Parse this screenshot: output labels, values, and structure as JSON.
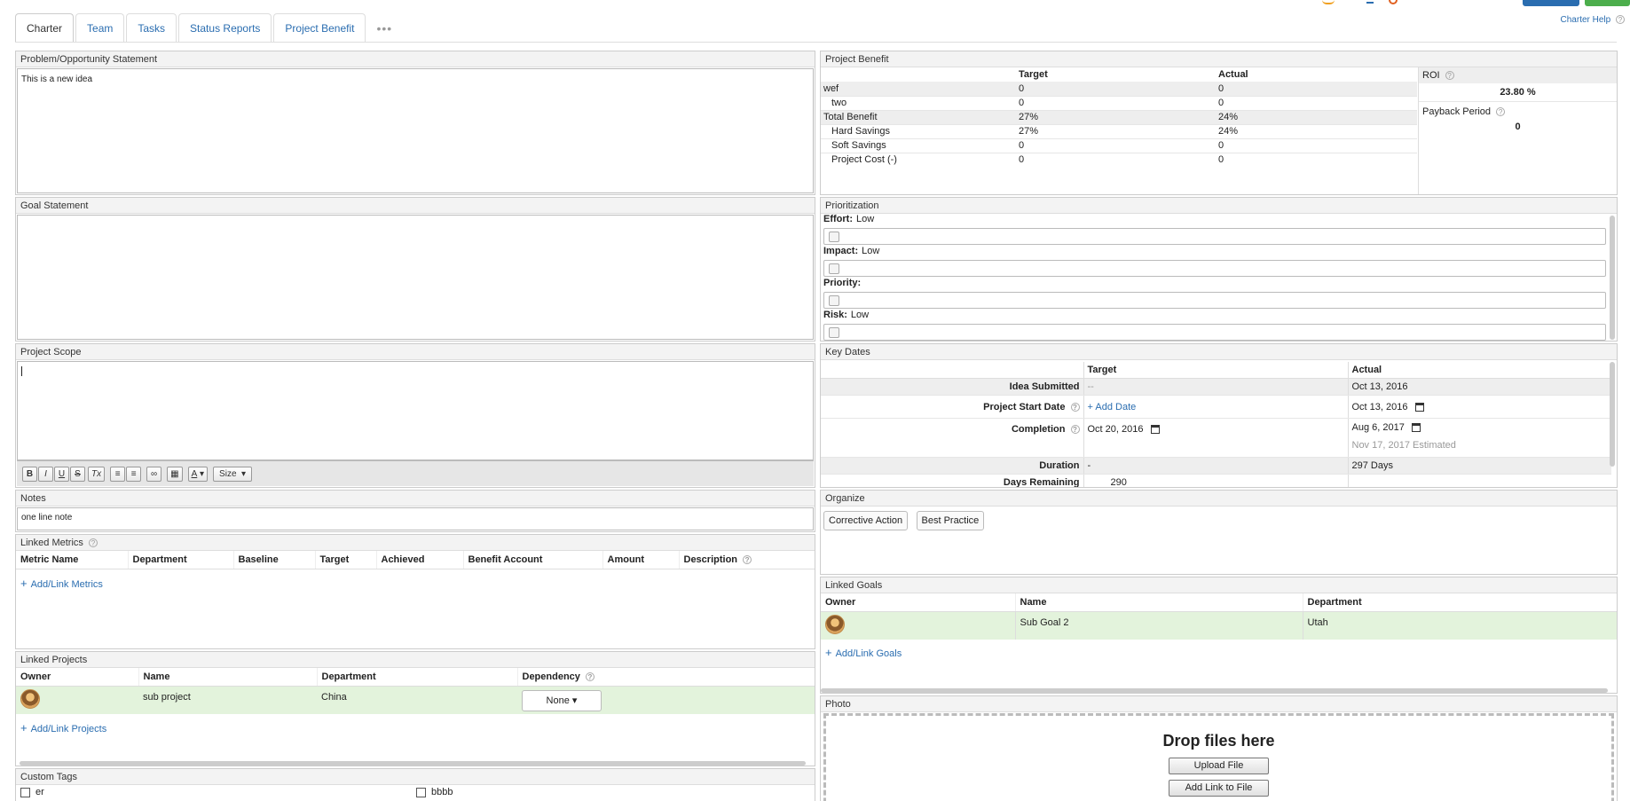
{
  "tabs": [
    "Charter",
    "Team",
    "Tasks",
    "Status Reports",
    "Project Benefit"
  ],
  "tab_more": "•••",
  "help_link": "Charter Help",
  "problem": {
    "title": "Problem/Opportunity Statement",
    "text": "This is a new idea"
  },
  "goal": {
    "title": "Goal Statement",
    "text": ""
  },
  "scope": {
    "title": "Project Scope",
    "toolbar": {
      "bold": "B",
      "italic": "I",
      "underline": "U",
      "strike": "S",
      "clear": "Tx",
      "font_color": "A",
      "size": "Size"
    }
  },
  "notes": {
    "title": "Notes",
    "text": "one line note"
  },
  "linked_metrics": {
    "title": "Linked Metrics",
    "columns": [
      "Metric Name",
      "Department",
      "Baseline",
      "Target",
      "Achieved",
      "Benefit Account",
      "Amount",
      "Description"
    ],
    "add_link": "Add/Link Metrics"
  },
  "linked_projects": {
    "title": "Linked Projects",
    "columns": [
      "Owner",
      "Name",
      "Department",
      "Dependency"
    ],
    "rows": [
      {
        "name": "sub project",
        "department": "China",
        "dependency": "None"
      }
    ],
    "add_link": "Add/Link Projects"
  },
  "custom_tags": {
    "title": "Custom Tags",
    "tags": [
      "er",
      "bbbb"
    ]
  },
  "project_benefit": {
    "title": "Project Benefit",
    "columns": [
      "Target",
      "Actual"
    ],
    "rows": [
      {
        "label": "wef",
        "target": "0",
        "actual": "0"
      },
      {
        "label": "two",
        "target": "0",
        "actual": "0"
      },
      {
        "label": "Total Benefit",
        "target": "27%",
        "actual": "24%"
      },
      {
        "label": "Hard Savings",
        "target": "27%",
        "actual": "24%"
      },
      {
        "label": "Soft Savings",
        "target": "0",
        "actual": "0"
      },
      {
        "label": "Project Cost (-)",
        "target": "0",
        "actual": "0"
      }
    ],
    "roi_label": "ROI",
    "roi_value": "23.80 %",
    "payback_label": "Payback Period",
    "payback_value": "0"
  },
  "prioritization": {
    "title": "Prioritization",
    "items": [
      {
        "label": "Effort:",
        "value": "Low"
      },
      {
        "label": "Impact:",
        "value": "Low"
      },
      {
        "label": "Priority:",
        "value": ""
      },
      {
        "label": "Risk:",
        "value": "Low"
      }
    ]
  },
  "key_dates": {
    "title": "Key Dates",
    "columns": [
      "Target",
      "Actual"
    ],
    "idea_submitted": {
      "label": "Idea Submitted",
      "target": "--",
      "actual": "Oct 13, 2016"
    },
    "start": {
      "label": "Project Start Date",
      "target": "+ Add Date",
      "actual": "Oct 13, 2016"
    },
    "completion": {
      "label": "Completion",
      "target": "Oct 20, 2016",
      "actual": "Aug 6, 2017",
      "estimated": "Nov 17, 2017 Estimated"
    },
    "duration": {
      "label": "Duration",
      "target": "-",
      "actual": "297 Days"
    },
    "remaining": {
      "label": "Days Remaining",
      "target": "290"
    }
  },
  "organize": {
    "title": "Organize",
    "chips": [
      "Corrective Action",
      "Best Practice"
    ]
  },
  "linked_goals": {
    "title": "Linked Goals",
    "columns": [
      "Owner",
      "Name",
      "Department"
    ],
    "rows": [
      {
        "name": "Sub Goal 2",
        "department": "Utah"
      }
    ],
    "add_link": "Add/Link Goals"
  },
  "photo": {
    "title": "Photo",
    "drop_text": "Drop files here",
    "upload_button": "Upload File",
    "link_button": "Add Link to File"
  },
  "colors": {
    "accent": "#2a6db0",
    "highlight_row": "#e3f3dc",
    "panel_header": "#f3f3f3"
  }
}
